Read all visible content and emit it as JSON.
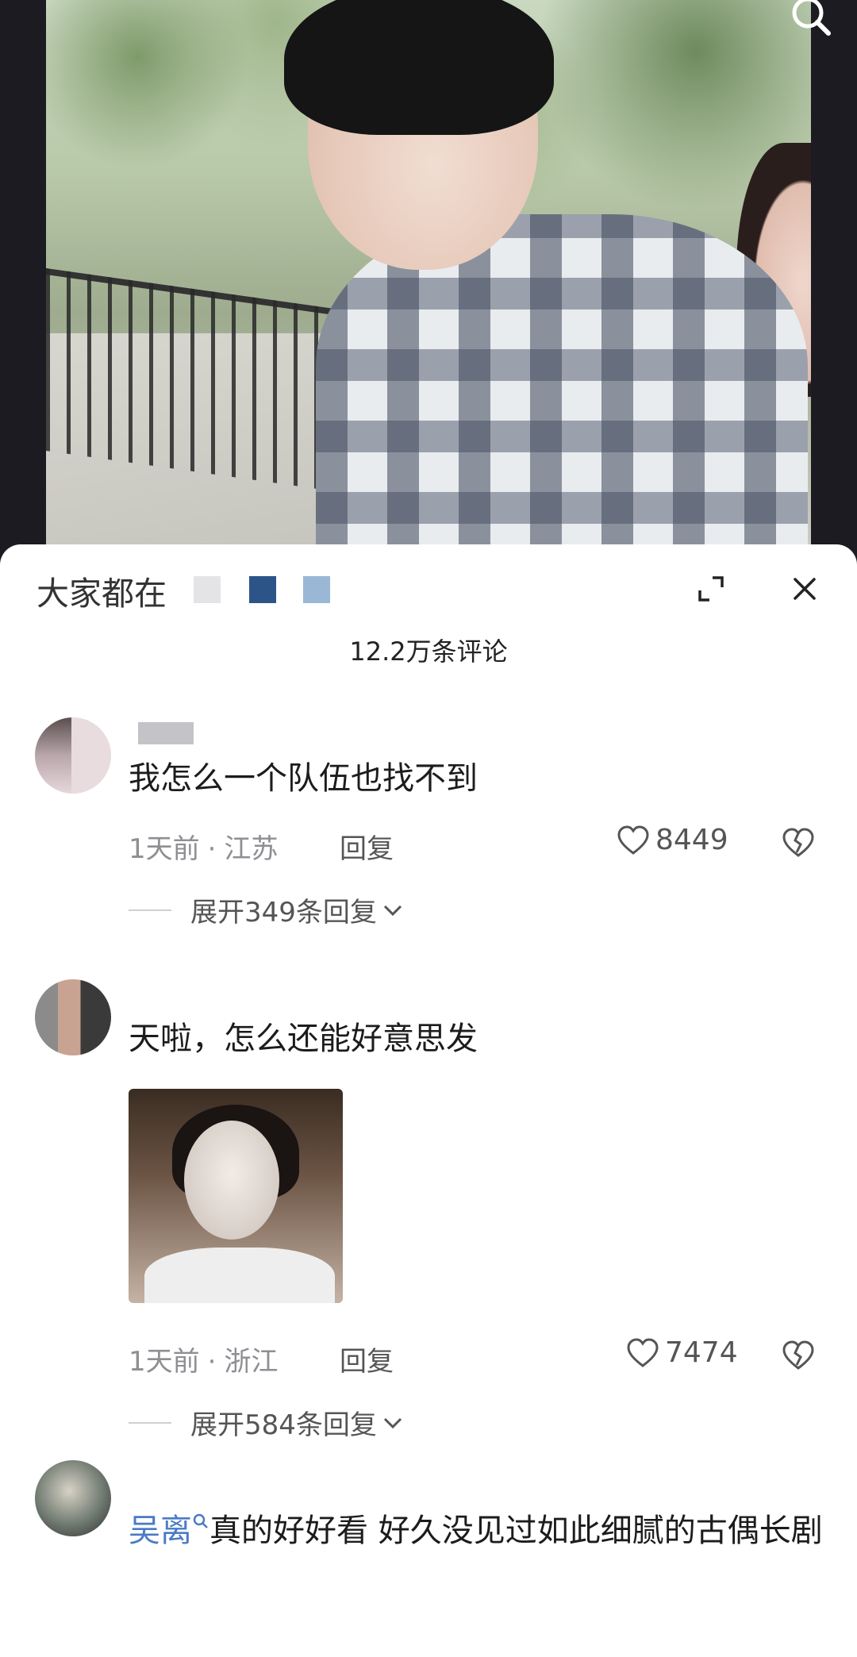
{
  "sheet": {
    "title": "大家都在",
    "comment_count": "12.2万条评论"
  },
  "comments": [
    {
      "text": "我怎么一个队伍也找不到",
      "time": "1天前",
      "location": "江苏",
      "reply_label": "回复",
      "likes": "8449",
      "expand_label": "展开349条回复"
    },
    {
      "text": "天啦，怎么还能好意思发",
      "time": "1天前",
      "location": "浙江",
      "reply_label": "回复",
      "likes": "7474",
      "expand_label": "展开584条回复"
    },
    {
      "name": "吴离",
      "text": "真的好好看 好久没见过如此细腻的古偶长剧"
    }
  ],
  "colors": {
    "accent_blue": "#4a7bc4",
    "meta_gray": "#8e8e93"
  }
}
